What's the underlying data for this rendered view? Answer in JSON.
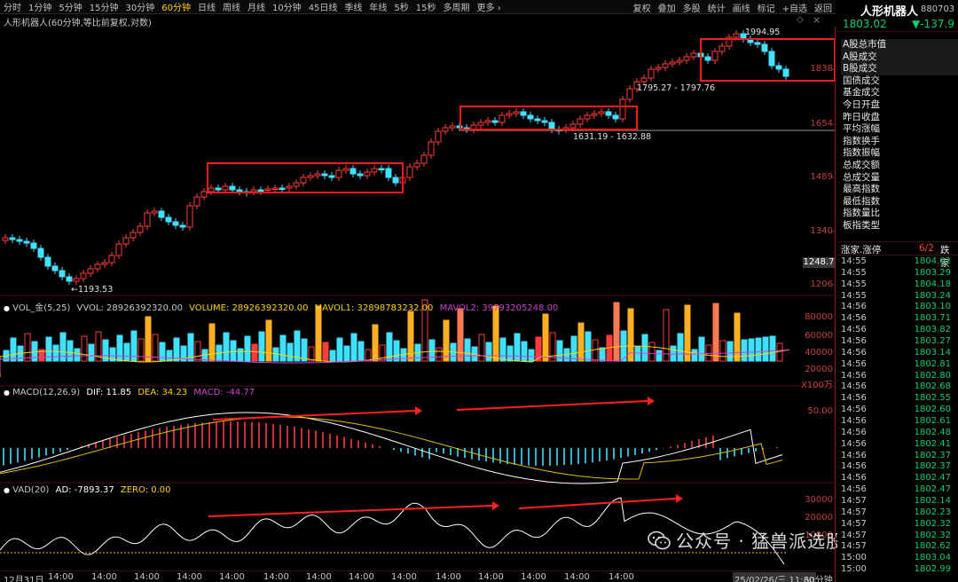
{
  "toolbar": {
    "items": [
      "分时",
      "1分钟",
      "5分钟",
      "15分钟",
      "30分钟",
      "60分钟",
      "日线",
      "周线",
      "月线",
      "10分钟",
      "45日线",
      "季线",
      "年线",
      "5秒",
      "15秒",
      "多周期",
      "更多 ›"
    ],
    "active_index": 5,
    "right_items": [
      "复权",
      "叠加",
      "多股",
      "统计",
      "画线",
      "标记",
      "+自选",
      "返回"
    ]
  },
  "chart": {
    "subtitle": "人形机器人(60分钟,等比前复权,对数)",
    "settings_icon": "◇",
    "close_icon": "×",
    "price_ticks": [
      "1838",
      "1654",
      "1489",
      "1340",
      "1206"
    ],
    "current_price_tag": "1248.7",
    "annotations": {
      "low": "←1193.53",
      "high": "1994.95",
      "mid1": "1795.27 - 1797.76",
      "mid2": "1631.19 - 1632.88"
    }
  },
  "vol_panel": {
    "name": "VOL_金(5,25)",
    "vvol": "VVOL: 28926392320.00",
    "volume": "VOLUME: 28926392320.00",
    "mavol1": "MAVOL1: 32898783232.00",
    "mavol2": "MAVOL2: 39793205248.00",
    "ticks": [
      "80000",
      "60000",
      "40000",
      "20000",
      "X100万"
    ]
  },
  "macd_panel": {
    "name": "MACD(12,26,9)",
    "dif": "DIF: 11.85",
    "dea": "DEA: 34.23",
    "macd": "MACD: -44.77",
    "ticks": [
      "50.00"
    ]
  },
  "vad_panel": {
    "name": "VAD(20)",
    "ad": "AD: -7893.37",
    "zero": "ZERO: 0.00",
    "ticks": [
      "30000",
      "20000",
      "10000"
    ]
  },
  "xaxis": {
    "labels": [
      "12月31日",
      "14:00",
      "14:00",
      "14:00",
      "14:00",
      "14:00",
      "14:00",
      "14:00",
      "14:00",
      "14:00",
      "14:00",
      "14:00",
      "14:00",
      "14:00",
      "14:00",
      "25/02/26/三 11:30"
    ],
    "unit": "60分钟"
  },
  "right_panel": {
    "name": "人形机器人",
    "code": "880703",
    "price": "1803.02",
    "change": "▼-137.9",
    "menu": [
      "A股总市值",
      "A股成交",
      "B股成交",
      "国债成交",
      "基金成交",
      "今日开盘",
      "昨日收盘",
      "平均涨幅",
      "指数换手",
      "指数振幅",
      "总成交额",
      "总成交量",
      "最高指数",
      "最低指数",
      "指数量比",
      "板指类型"
    ],
    "zhang_label": "涨家.涨停",
    "zhang_value": "6/2",
    "die_label": "跌家",
    "ticks": [
      {
        "t": "14:55",
        "p": "1804.02"
      },
      {
        "t": "14:55",
        "p": "1803.29"
      },
      {
        "t": "14:55",
        "p": "1804.18"
      },
      {
        "t": "14:55",
        "p": "1803.24"
      },
      {
        "t": "14:56",
        "p": "1803.10"
      },
      {
        "t": "14:56",
        "p": "1803.71"
      },
      {
        "t": "14:56",
        "p": "1803.82"
      },
      {
        "t": "14:56",
        "p": "1803.27"
      },
      {
        "t": "14:56",
        "p": "1803.14"
      },
      {
        "t": "14:56",
        "p": "1802.81"
      },
      {
        "t": "14:56",
        "p": "1802.80"
      },
      {
        "t": "14:56",
        "p": "1802.68"
      },
      {
        "t": "14:56",
        "p": "1802.55"
      },
      {
        "t": "14:56",
        "p": "1802.60"
      },
      {
        "t": "14:56",
        "p": "1802.61"
      },
      {
        "t": "14:56",
        "p": "1802.48"
      },
      {
        "t": "14:56",
        "p": "1802.41"
      },
      {
        "t": "14:56",
        "p": "1802.37"
      },
      {
        "t": "14:56",
        "p": "1802.37"
      },
      {
        "t": "14:56",
        "p": "1802.47"
      },
      {
        "t": "14:56",
        "p": "1802.47"
      },
      {
        "t": "14:57",
        "p": "1802.14"
      },
      {
        "t": "14:57",
        "p": "1802.23"
      },
      {
        "t": "14:57",
        "p": "1802.32"
      },
      {
        "t": "14:57",
        "p": "1802.32"
      },
      {
        "t": "14:57",
        "p": "1802.62"
      },
      {
        "t": "15:00",
        "p": "1803.04"
      },
      {
        "t": "15:00",
        "p": "1802.99"
      }
    ]
  },
  "watermark": "公众号 · 猛兽派选股",
  "colors": {
    "up": "#ff3b3b",
    "down": "#40e0ff",
    "dif": "#ffffff",
    "dea": "#e0c000",
    "box": "#ff1a1a",
    "green": "#00d070"
  }
}
